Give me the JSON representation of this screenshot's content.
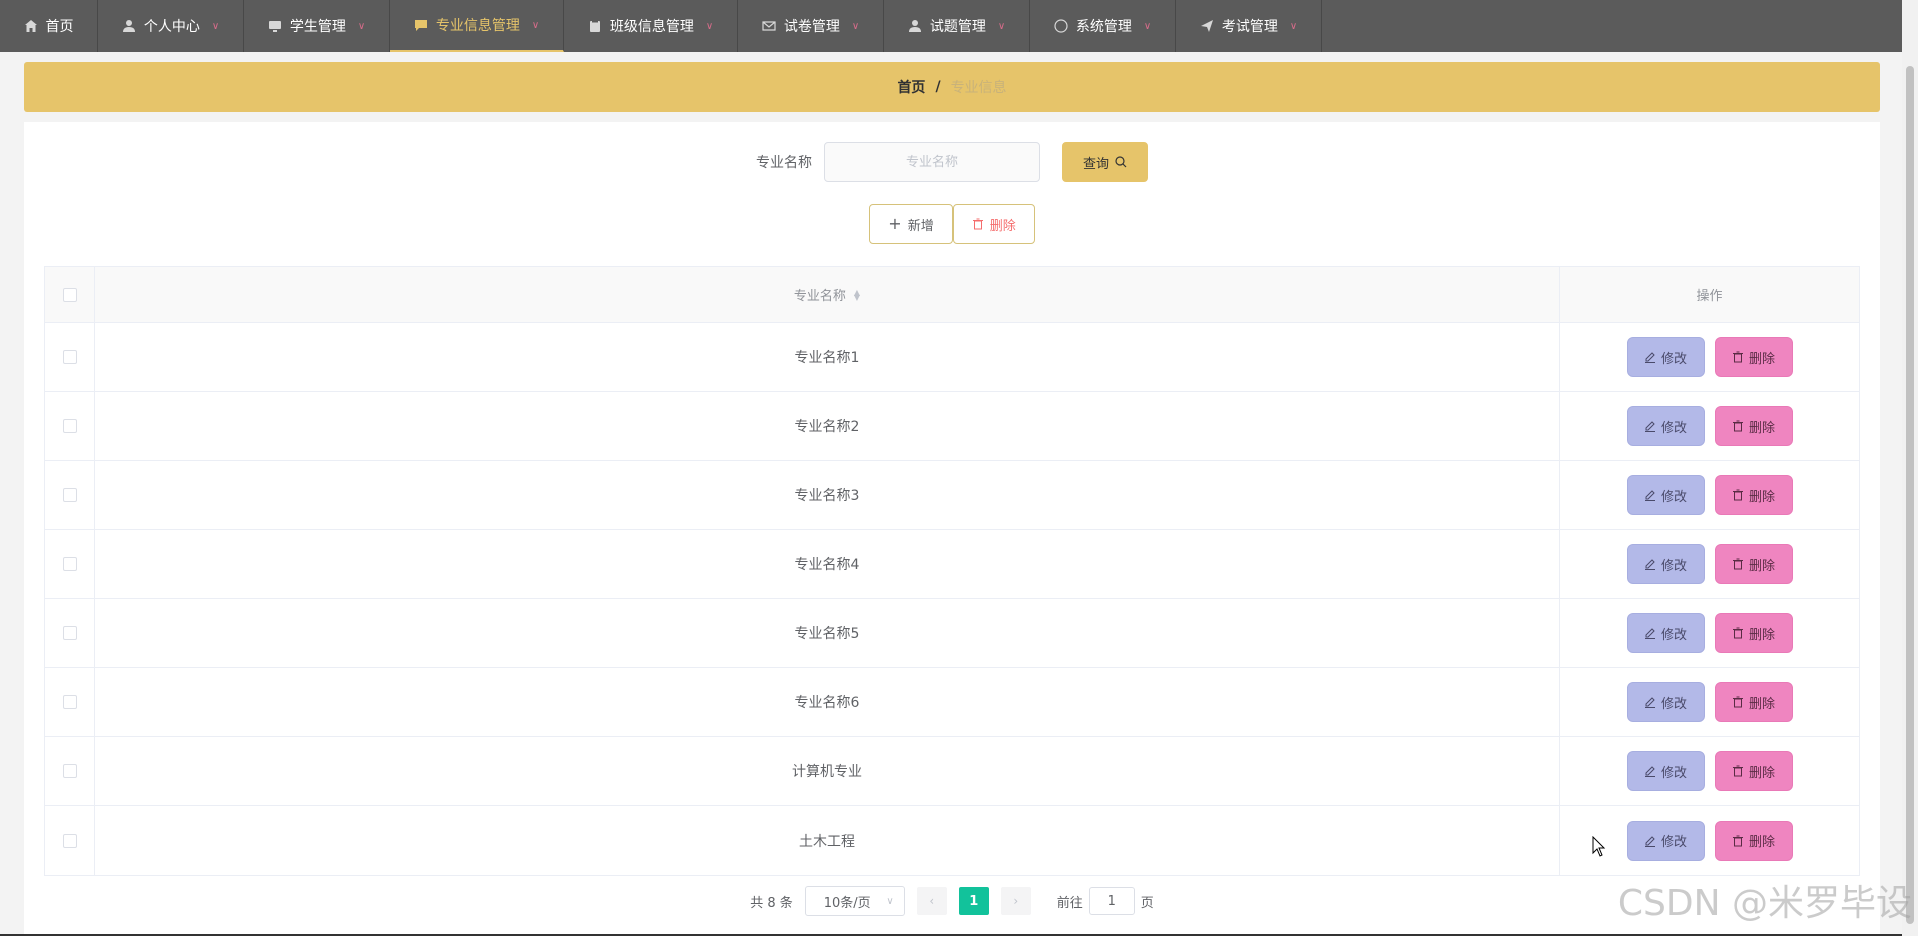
{
  "nav": {
    "items": [
      {
        "label": "首页",
        "icon": "home-icon",
        "chevron": false,
        "width": 98
      },
      {
        "label": "个人中心",
        "icon": "user-icon",
        "chevron": true,
        "width": 146
      },
      {
        "label": "学生管理",
        "icon": "monitor-icon",
        "chevron": true,
        "width": 146
      },
      {
        "label": "专业信息管理",
        "icon": "chat-icon",
        "chevron": true,
        "width": 174,
        "active": true
      },
      {
        "label": "班级信息管理",
        "icon": "clipboard-icon",
        "chevron": true,
        "width": 174
      },
      {
        "label": "试卷管理",
        "icon": "mail-icon",
        "chevron": true,
        "width": 146
      },
      {
        "label": "试题管理",
        "icon": "user-icon",
        "chevron": true,
        "width": 146
      },
      {
        "label": "系统管理",
        "icon": "compass-icon",
        "chevron": true,
        "width": 146
      },
      {
        "label": "考试管理",
        "icon": "send-icon",
        "chevron": true,
        "width": 146
      }
    ]
  },
  "breadcrumb": {
    "home": "首页",
    "sep": "/",
    "current": "专业信息"
  },
  "search": {
    "label": "专业名称",
    "placeholder": "专业名称",
    "query_label": "查询"
  },
  "actions": {
    "add_label": "新增",
    "delete_label": "删除"
  },
  "table": {
    "headers": {
      "name": "专业名称",
      "ops": "操作"
    },
    "rows": [
      "专业名称1",
      "专业名称2",
      "专业名称3",
      "专业名称4",
      "专业名称5",
      "专业名称6",
      "计算机专业",
      "土木工程"
    ],
    "edit_label": "修改",
    "remove_label": "删除"
  },
  "pagination": {
    "total": "共 8 条",
    "page_size": "10条/页",
    "current": "1",
    "goto_prefix": "前往",
    "goto_value": "1",
    "goto_suffix": "页"
  },
  "watermark": "CSDN @米罗毕设",
  "colors": {
    "accent": "#e6c46a",
    "nav_bg": "#5b5b5b",
    "edit": "#b3b9e8",
    "remove": "#ef85c0",
    "page_active": "#12c29b"
  }
}
